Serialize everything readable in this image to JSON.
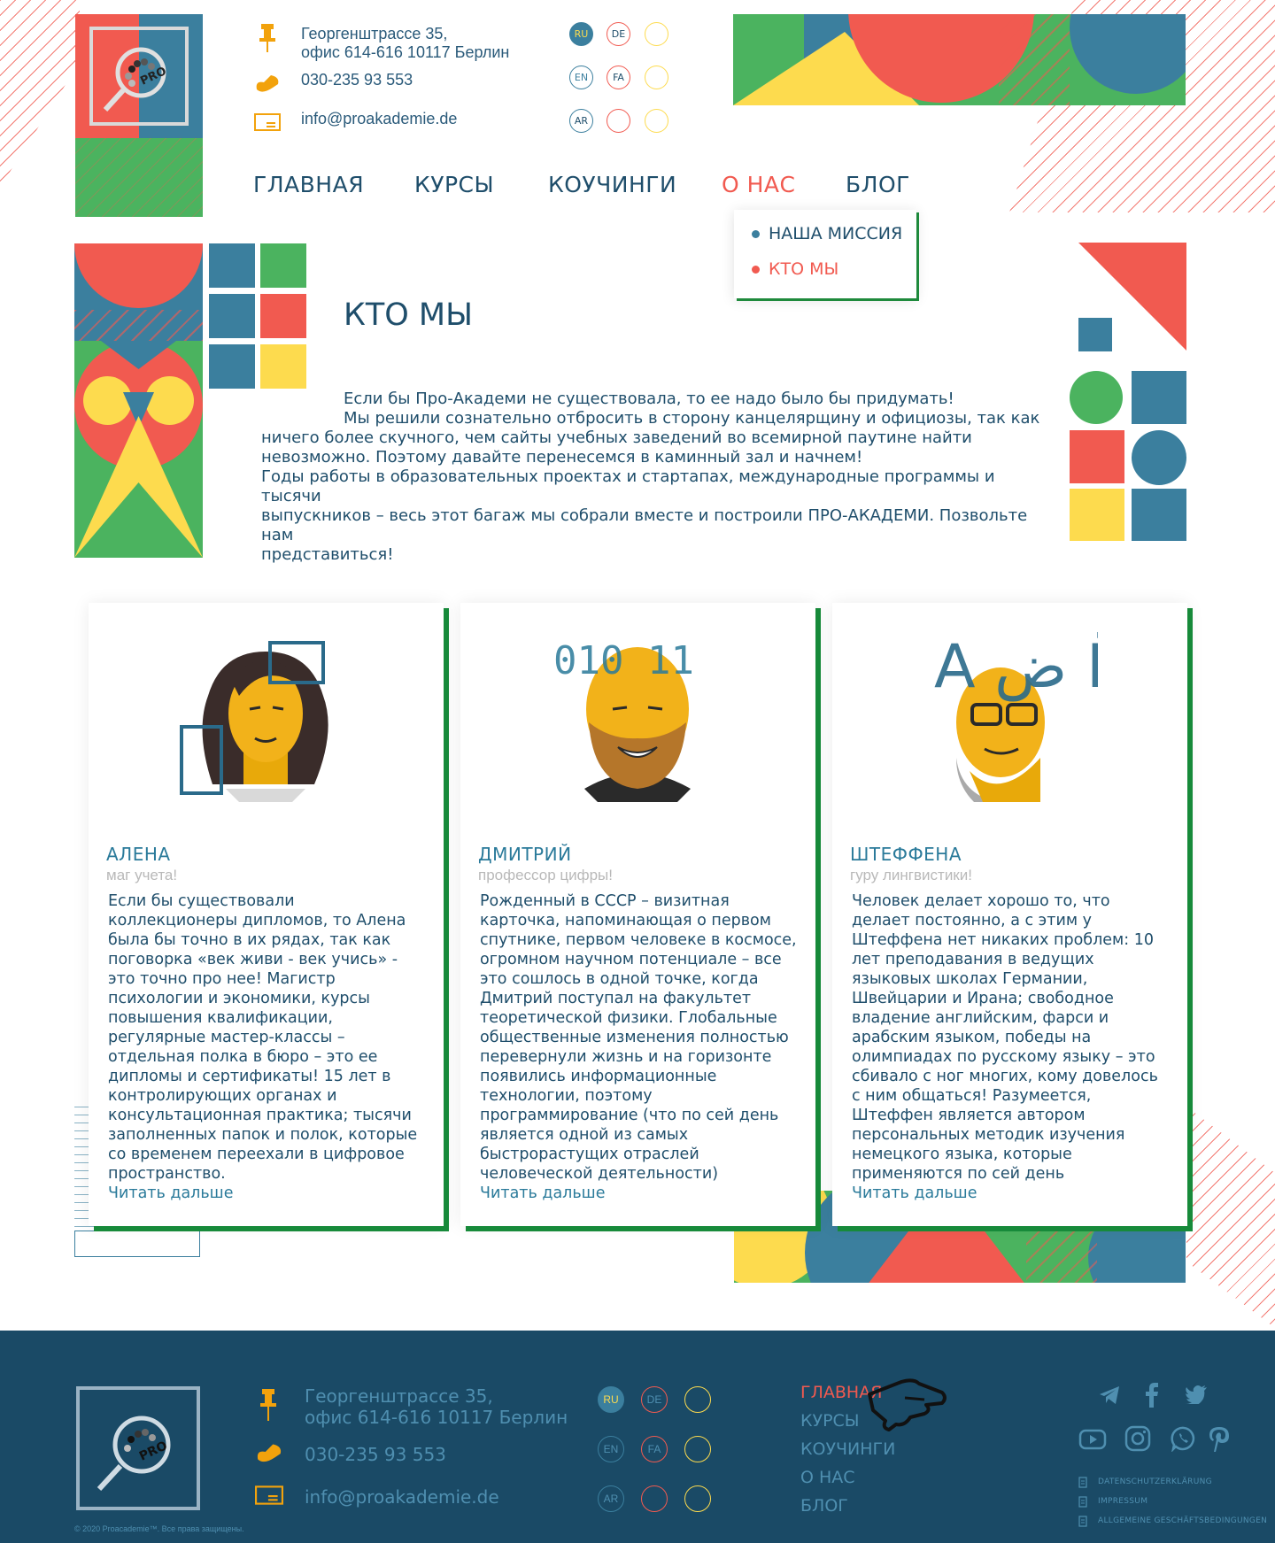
{
  "header": {
    "address_line1": "Георгенштрассе 35,",
    "address_line2": "офис 614-616 10117 Берлин",
    "phone": "030-235 93 553",
    "email": "info@proakademie.de",
    "logo_text": "PRO",
    "languages": [
      "RU",
      "DE",
      "EN",
      "FA",
      "AR"
    ],
    "nav": [
      "ГЛАВНАЯ",
      "КУРСЫ",
      "КОУЧИНГИ",
      "О НАС",
      "БЛОГ"
    ],
    "dropdown": [
      "НАША МИССИЯ",
      "КТО МЫ"
    ]
  },
  "intro": {
    "title": "КТО МЫ",
    "line1": "Если бы Про-Академи не существовала, то ее надо было бы придумать!",
    "line2": "Мы решили сознательно отбросить в сторону канцелярщину и официозы, так как",
    "line3": "ничего более скучного, чем сайты учебных заведений во всемирной паутине найти",
    "line4": "невозможно. Поэтому давайте перенесемся в каминный зал и начнем!",
    "line5": "Годы работы в образовательных проектах и стартапах, международные программы и тысячи",
    "line6": "выпускников – весь этот багаж мы собрали вместе и построили ПРО-АКАДЕМИ. Позвольте нам",
    "line7": "представиться!"
  },
  "cards": [
    {
      "name": "АЛЕНА",
      "role": "маг учета!",
      "text": "Если бы существовали коллекционеры дипломов, то Алена была бы точно в их рядах, так как поговорка «век живи - век учись» - это точно про нее! Магистр психологии и экономики, курсы повышения квалификации, регулярные мастер-классы – отдельная полка в бюро – это ее дипломы и сертификаты! 15 лет в контролирующих органах и консультационная практика; тысячи заполненных папок и полок, которые со временем переехали в цифровое пространство.",
      "more": "Читать дальше"
    },
    {
      "name": "ДМИТРИЙ",
      "role": "профессор цифры!",
      "text": "Рожденный в СССР – визитная карточка, напоминающая о первом спутнике, первом человеке в космосе, огромном научном потенциале – все это сошлось в одной точке, когда Дмитрий поступал на факультет теоретической физики. Глобальные общественные изменения полностью перевернули жизнь и на горизонте появились информационные технологии, поэтому программирование (что по сей день является одной из самых быстрорастущих отраслей человеческой деятельности)",
      "more": "Читать дальше",
      "digits": "010 11"
    },
    {
      "name": "ШТЕФФЕНА",
      "role": "гуру лингвистики!",
      "text": "Человек делает хорошо то, что делает постоянно, а с этим у Штеффена нет никаких проблем: 10 лет преподавания в ведущих языковых школах Германии, Швейцарии и Ирана; свободное владение английским, фарси и арабским языком, победы на олимпиадах по русскому языку – это сбивало с ног многих, кому довелось с ним общаться! Разумеется, Штеффен является автором персональных методик изучения немецкого языка, которые применяются по сей день",
      "more": "Читать дальше",
      "letters": "A  ض  Ё"
    }
  ],
  "footer": {
    "address_line1": "Георгенштрассе 35,",
    "address_line2": "офис 614-616 10117 Берлин",
    "phone": "030-235 93 553",
    "email": "info@proakademie.de",
    "languages": [
      "RU",
      "DE",
      "EN",
      "FA",
      "AR"
    ],
    "nav": [
      "ГЛАВНАЯ",
      "КУРСЫ",
      "КОУЧИНГИ",
      "О НАС",
      "БЛОГ"
    ],
    "links": [
      "DATENSCHUTZERKLÄRUNG",
      "IMPRESSUM",
      "ALLGEMEINE GESCHÄFTSBEDINGUNGEN"
    ],
    "copyright": "© 2020 Proacademie™. Все права защищены."
  },
  "colors": {
    "teal": "#3b7f9e",
    "green": "#4bb35f",
    "red": "#f15a50",
    "yellow": "#fddb4e",
    "navy": "#1a4a66",
    "accent_green": "#178a3a"
  }
}
